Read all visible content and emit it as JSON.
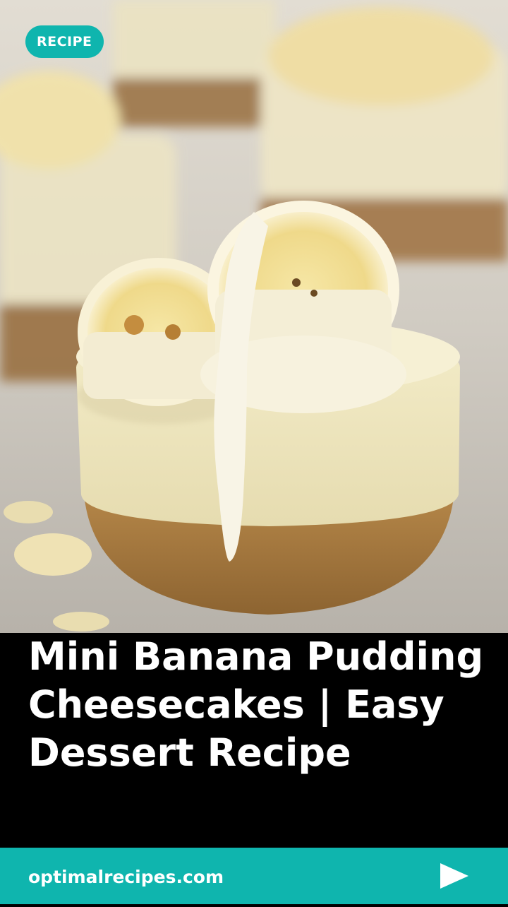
{
  "badge": {
    "label": "RECIPE"
  },
  "title": {
    "text": "Mini Banana Pudding Cheesecakes | Easy Dessert Recipe"
  },
  "footer": {
    "site": "optimalrecipes.com",
    "play_icon": "play-icon"
  },
  "colors": {
    "accent": "#0fb5ae",
    "title_bg": "#000000",
    "text": "#ffffff"
  }
}
